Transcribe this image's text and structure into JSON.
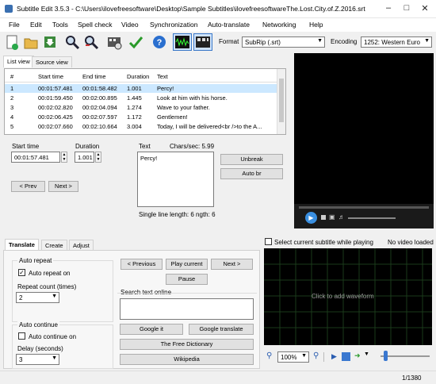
{
  "window": {
    "title": "Subtitle Edit 3.5.3 - C:\\Users\\ilovefreesoftware\\Desktop\\Sample Subtitles\\ilovefreesoftwareThe.Lost.City.of.Z.2016.srt"
  },
  "menu": [
    "File",
    "Edit",
    "Tools",
    "Spell check",
    "Video",
    "Synchronization",
    "Auto-translate",
    "Networking",
    "Help"
  ],
  "toolbar": {
    "format_label": "Format",
    "format_value": "SubRip (.srt)",
    "encoding_label": "Encoding",
    "encoding_value": "1252: Western Euro"
  },
  "list_tabs": [
    "List view",
    "Source view"
  ],
  "grid": {
    "columns": [
      "#",
      "Start time",
      "End time",
      "Duration",
      "Text"
    ],
    "rows": [
      {
        "n": "1",
        "start": "00:01:57.481",
        "end": "00:01:58.482",
        "dur": "1.001",
        "text": "Percy!"
      },
      {
        "n": "2",
        "start": "00:01:59.450",
        "end": "00:02:00.895",
        "dur": "1.445",
        "text": "Look at him with his horse."
      },
      {
        "n": "3",
        "start": "00:02:02.820",
        "end": "00:02:04.094",
        "dur": "1.274",
        "text": "Wave to your father."
      },
      {
        "n": "4",
        "start": "00:02:06.425",
        "end": "00:02:07.597",
        "dur": "1.172",
        "text": "Gentlemen!"
      },
      {
        "n": "5",
        "start": "00:02:07.660",
        "end": "00:02:10.664",
        "dur": "3.004",
        "text": "Today, I will be delivered<br />to the A..."
      }
    ]
  },
  "editor": {
    "start_label": "Start time",
    "start_value": "00:01:57.481",
    "duration_label": "Duration",
    "duration_value": "1.001",
    "text_label": "Text",
    "chars_label": "Chars/sec: 5.99",
    "text_value": "Percy!",
    "unbreak": "Unbreak",
    "autobr": "Auto br",
    "prev": "< Prev",
    "next": "Next >",
    "line_length": "Single line length: 6  ngth: 6"
  },
  "bottom_tabs": [
    "Translate",
    "Create",
    "Adjust"
  ],
  "translate": {
    "auto_repeat_title": "Auto repeat",
    "auto_repeat_on": "Auto repeat on",
    "repeat_count_label": "Repeat count (times)",
    "repeat_count_value": "2",
    "auto_continue_title": "Auto continue",
    "auto_continue_on": "Auto continue on",
    "delay_label": "Delay (seconds)",
    "delay_value": "3",
    "previous": "< Previous",
    "play_current": "Play current",
    "next": "Next >",
    "pause": "Pause",
    "search_label": "Search text online",
    "google_it": "Google it",
    "google_translate": "Google translate",
    "free_dictionary": "The Free Dictionary",
    "wikipedia": "Wikipedia"
  },
  "waveform": {
    "select_current": "Select current subtitle while playing",
    "no_video": "No video loaded",
    "click_to_add": "Click to add waveform",
    "zoom": "100%"
  },
  "status": {
    "position": "1/1380"
  }
}
